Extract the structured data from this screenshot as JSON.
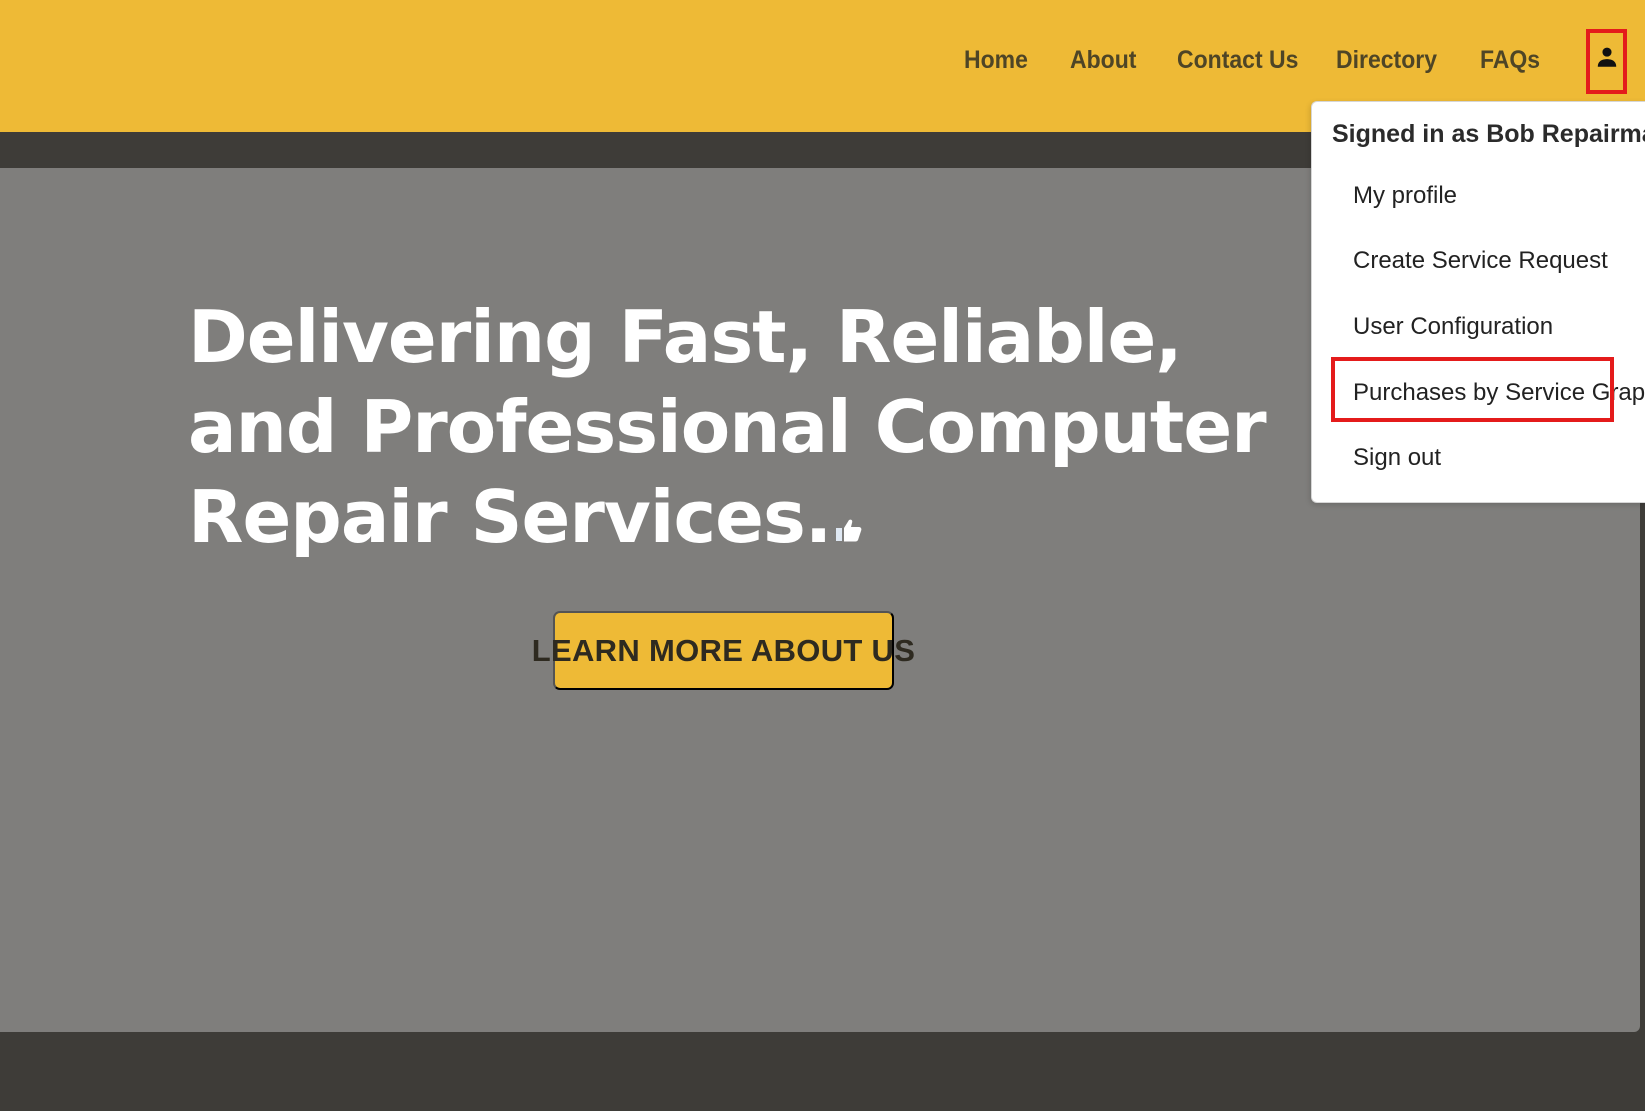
{
  "nav": {
    "items": [
      {
        "label": "Home"
      },
      {
        "label": "About"
      },
      {
        "label": "Contact Us"
      },
      {
        "label": "Directory"
      },
      {
        "label": "FAQs"
      }
    ],
    "user_icon": "person-icon"
  },
  "hero": {
    "title": "Delivering Fast, Reliable, and Professional Computer Repair Services.",
    "title_icon": "thumbs-up-icon",
    "button_label": "LEARN MORE ABOUT US"
  },
  "user_menu": {
    "header": "Signed in as Bob Repairman",
    "items": [
      {
        "label": "My profile"
      },
      {
        "label": "Create Service Request"
      },
      {
        "label": "User Configuration"
      },
      {
        "label": "Purchases by Service Graph"
      },
      {
        "label": "Sign out"
      }
    ]
  },
  "colors": {
    "brand_yellow": "#eeba36",
    "dark_band": "#3e3c38",
    "hero_gray": "#7f7e7c",
    "nav_text": "#4e4526",
    "annotation_red": "#e41b1b"
  }
}
